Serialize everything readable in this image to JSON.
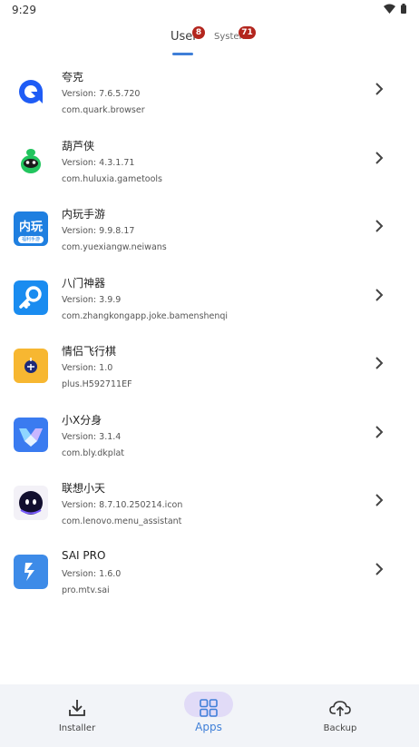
{
  "status_bar": {
    "time": "9:29"
  },
  "tabs": {
    "user": {
      "label": "User",
      "count": "8"
    },
    "system": {
      "label": "System",
      "count": "71"
    }
  },
  "apps": [
    {
      "name": "夸克",
      "version": "Version: 7.6.5.720",
      "package": "com.quark.browser",
      "icon": "quark-icon"
    },
    {
      "name": "葫芦侠",
      "version": "Version: 4.3.1.71",
      "package": "com.huluxia.gametools",
      "icon": "huluxia-icon"
    },
    {
      "name": "内玩手游",
      "version": "Version: 9.9.8.17",
      "package": "com.yuexiangw.neiwans",
      "icon": "neiwan-icon",
      "icon_text": "内玩",
      "icon_subtext": "福利手游"
    },
    {
      "name": "八门神器",
      "version": "Version: 3.9.9",
      "package": "com.zhangkongapp.joke.bamenshenqi",
      "icon": "bamen-icon"
    },
    {
      "name": "情侣飞行棋",
      "version": "Version: 1.0",
      "package": "plus.H592711EF",
      "icon": "couple-chess-icon"
    },
    {
      "name": "小X分身",
      "version": "Version: 3.1.4",
      "package": "com.bly.dkplat",
      "icon": "xiaox-icon"
    },
    {
      "name": "联想小天",
      "version": "Version: 8.7.10.250214.icon",
      "package": "com.lenovo.menu_assistant",
      "icon": "lenovo-assistant-icon"
    },
    {
      "name": "SAI PRO",
      "version": "Version: 1.6.0",
      "package": "pro.mtv.sai",
      "icon": "sai-icon"
    }
  ],
  "bottom_nav": {
    "installer": "Installer",
    "apps": "Apps",
    "backup": "Backup"
  },
  "colors": {
    "accent": "#3f7fd8",
    "badge": "#b3261e",
    "nav_bg": "#f2f4f8",
    "nav_pill": "#e1dbf7"
  }
}
